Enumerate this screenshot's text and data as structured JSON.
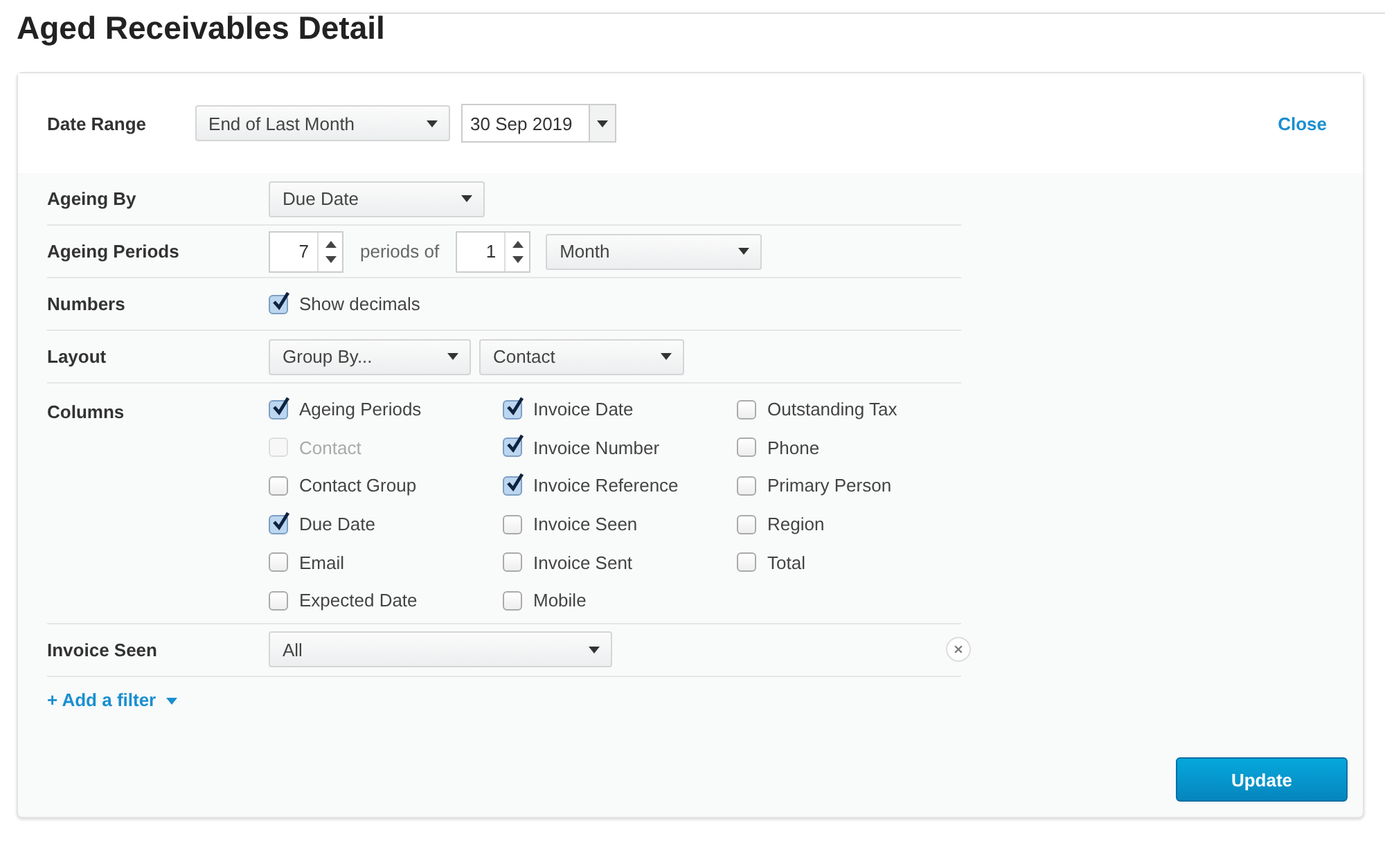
{
  "title": "Aged Receivables Detail",
  "date_range": {
    "label": "Date Range",
    "preset": "End of Last Month",
    "date": "30 Sep 2019",
    "close": "Close"
  },
  "ageing_by": {
    "label": "Ageing By",
    "value": "Due Date"
  },
  "ageing_periods": {
    "label": "Ageing Periods",
    "count": "7",
    "between": "periods of",
    "length": "1",
    "unit": "Month"
  },
  "numbers": {
    "label": "Numbers",
    "option": {
      "label": "Show decimals",
      "checked": true,
      "disabled": false
    }
  },
  "layout": {
    "label": "Layout",
    "group_by": "Group By...",
    "value": "Contact"
  },
  "columns": {
    "label": "Columns",
    "options": [
      [
        {
          "label": "Ageing Periods",
          "checked": true,
          "disabled": false
        },
        {
          "label": "Contact",
          "checked": false,
          "disabled": true
        },
        {
          "label": "Contact Group",
          "checked": false,
          "disabled": false
        },
        {
          "label": "Due Date",
          "checked": true,
          "disabled": false
        },
        {
          "label": "Email",
          "checked": false,
          "disabled": false
        },
        {
          "label": "Expected Date",
          "checked": false,
          "disabled": false
        }
      ],
      [
        {
          "label": "Invoice Date",
          "checked": true,
          "disabled": false
        },
        {
          "label": "Invoice Number",
          "checked": true,
          "disabled": false
        },
        {
          "label": "Invoice Reference",
          "checked": true,
          "disabled": false
        },
        {
          "label": "Invoice Seen",
          "checked": false,
          "disabled": false
        },
        {
          "label": "Invoice Sent",
          "checked": false,
          "disabled": false
        },
        {
          "label": "Mobile",
          "checked": false,
          "disabled": false
        }
      ],
      [
        {
          "label": "Outstanding Tax",
          "checked": false,
          "disabled": false
        },
        {
          "label": "Phone",
          "checked": false,
          "disabled": false
        },
        {
          "label": "Primary Person",
          "checked": false,
          "disabled": false
        },
        {
          "label": "Region",
          "checked": false,
          "disabled": false
        },
        {
          "label": "Total",
          "checked": false,
          "disabled": false
        }
      ]
    ]
  },
  "filter": {
    "label": "Invoice Seen",
    "value": "All"
  },
  "add_filter": "+ Add a filter",
  "update": "Update"
}
